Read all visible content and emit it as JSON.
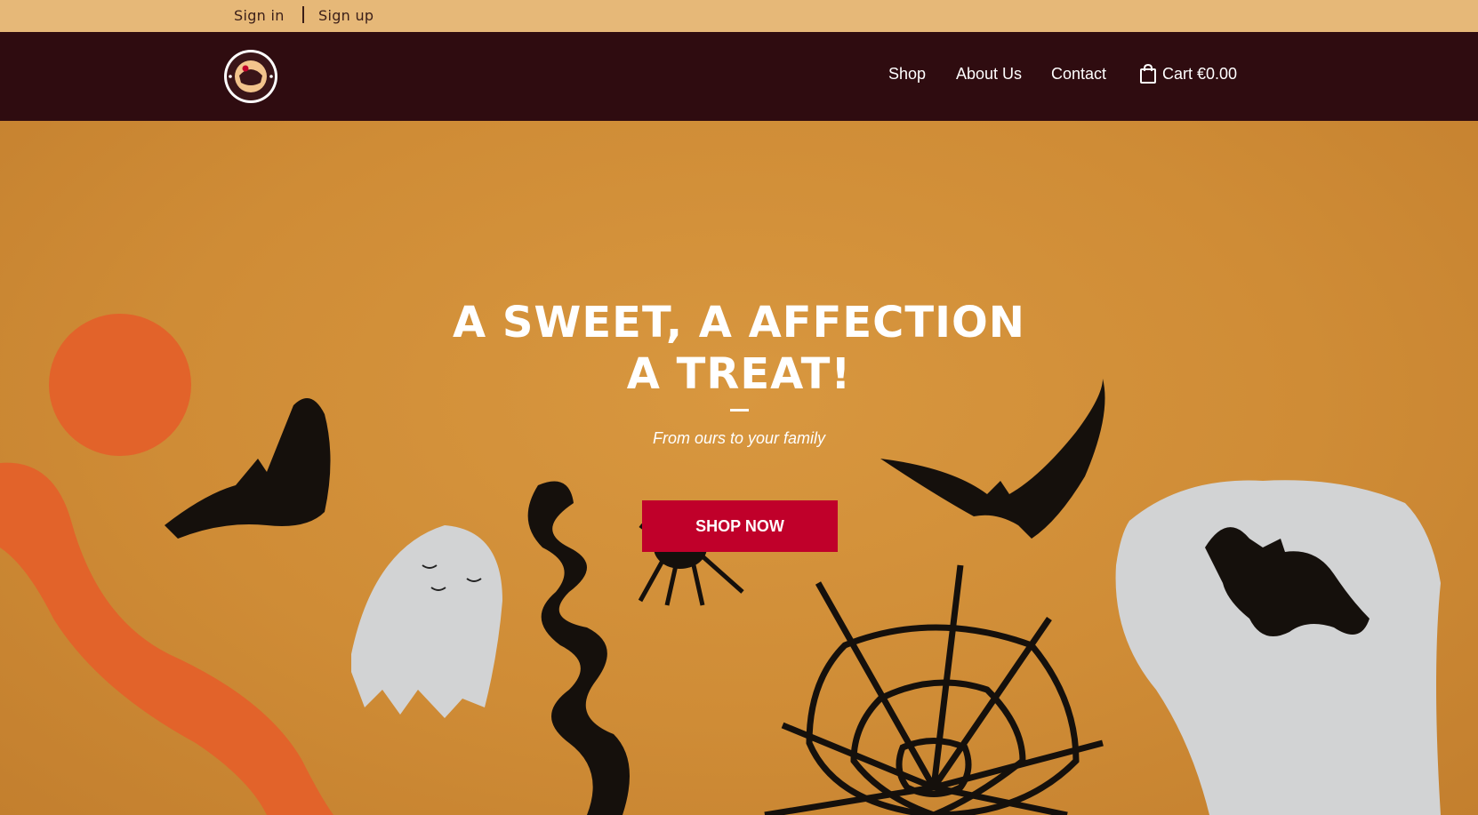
{
  "topbar": {
    "sign_in": "Sign in",
    "sign_up": "Sign up"
  },
  "nav": {
    "logo_icon": "candy-cake-logo-icon",
    "items": [
      {
        "label": "Shop"
      },
      {
        "label": "About Us"
      },
      {
        "label": "Contact"
      }
    ],
    "cart": {
      "icon": "shopping-bag-icon",
      "label": "Cart €0.00"
    }
  },
  "hero": {
    "title_line1": "A SWEET, A AFFECTION",
    "title_line2": "A TREAT!",
    "subtitle": "From ours to your family",
    "cta_label": "SHOP NOW",
    "background": "halloween-decorations-image"
  },
  "colors": {
    "topbar_bg": "#e6b878",
    "navbar_bg": "#2f0c10",
    "hero_bg": "#cf8c36",
    "cta_bg": "#c0002a"
  }
}
